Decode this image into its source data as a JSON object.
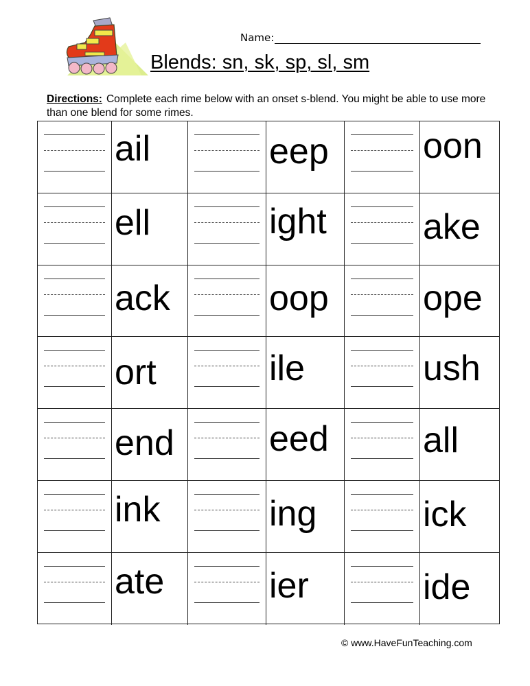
{
  "header": {
    "logo_icon": "inline-skate-icon",
    "name_label": "Name:",
    "title": "Blends: sn, sk, sp, sl, sm"
  },
  "directions": {
    "label": "Directions:",
    "text": "Complete each rime below with an onset s-blend.  You might be able to use more than one blend for some rimes."
  },
  "worksheet": {
    "rows": [
      [
        "ail",
        "eep",
        "oon"
      ],
      [
        "ell",
        "ight",
        "ake"
      ],
      [
        "ack",
        "oop",
        "ope"
      ],
      [
        "ort",
        "ile",
        "ush"
      ],
      [
        "end",
        "eed",
        "all"
      ],
      [
        "ink",
        "ing",
        "ick"
      ],
      [
        "ate",
        "ier",
        "ide"
      ]
    ]
  },
  "footer": {
    "copyright": "© www.HaveFunTeaching.com"
  }
}
